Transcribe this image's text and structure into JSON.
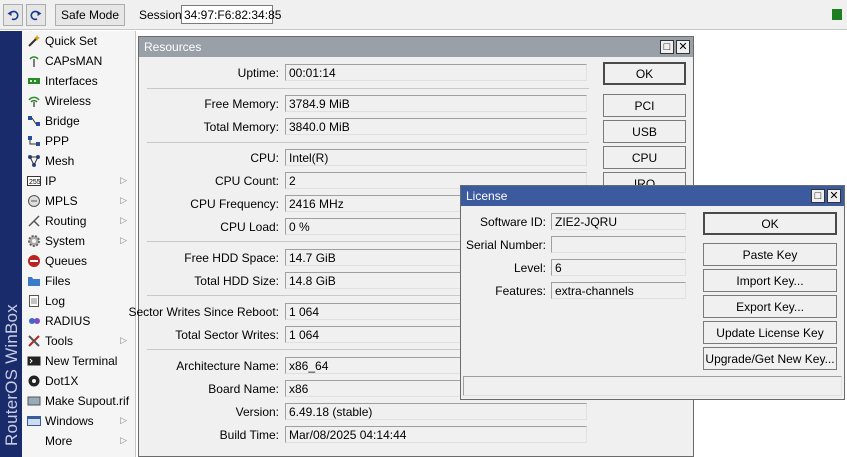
{
  "toolbar": {
    "safe_mode_label": "Safe Mode",
    "session_label": "Session:",
    "session_value": "34:97:F6:82:34:85"
  },
  "brand": "RouterOS WinBox",
  "sidebar": {
    "items": [
      {
        "label": "Quick Set",
        "icon": "wand-icon"
      },
      {
        "label": "CAPsMAN",
        "icon": "antenna-icon"
      },
      {
        "label": "Interfaces",
        "icon": "interfaces-icon"
      },
      {
        "label": "Wireless",
        "icon": "wireless-icon"
      },
      {
        "label": "Bridge",
        "icon": "bridge-icon"
      },
      {
        "label": "PPP",
        "icon": "ppp-icon"
      },
      {
        "label": "Mesh",
        "icon": "mesh-icon"
      },
      {
        "label": "IP",
        "icon": "ip-icon"
      },
      {
        "label": "MPLS",
        "icon": "mpls-icon"
      },
      {
        "label": "Routing",
        "icon": "routing-icon"
      },
      {
        "label": "System",
        "icon": "gear-icon"
      },
      {
        "label": "Queues",
        "icon": "queues-icon"
      },
      {
        "label": "Files",
        "icon": "folder-icon"
      },
      {
        "label": "Log",
        "icon": "log-icon"
      },
      {
        "label": "RADIUS",
        "icon": "radius-icon"
      },
      {
        "label": "Tools",
        "icon": "tools-icon"
      },
      {
        "label": "New Terminal",
        "icon": "terminal-icon"
      },
      {
        "label": "Dot1X",
        "icon": "dot1x-icon"
      },
      {
        "label": "Make Supout.rif",
        "icon": "supout-icon"
      },
      {
        "label": "Windows",
        "icon": "windows-icon"
      },
      {
        "label": "More",
        "icon": ""
      }
    ]
  },
  "resources": {
    "title": "Resources",
    "uptime_label": "Uptime:",
    "uptime": "00:01:14",
    "free_memory_label": "Free Memory:",
    "free_memory": "3784.9 MiB",
    "total_memory_label": "Total Memory:",
    "total_memory": "3840.0 MiB",
    "cpu_label": "CPU:",
    "cpu": "Intel(R)",
    "cpu_count_label": "CPU Count:",
    "cpu_count": "2",
    "cpu_frequency_label": "CPU Frequency:",
    "cpu_frequency": "2416 MHz",
    "cpu_load_label": "CPU Load:",
    "cpu_load": "0 %",
    "free_hdd_label": "Free HDD Space:",
    "free_hdd": "14.7 GiB",
    "total_hdd_label": "Total HDD Size:",
    "total_hdd": "14.8 GiB",
    "sector_writes_reboot_label": "Sector Writes Since Reboot:",
    "sector_writes_reboot": "1 064",
    "total_sector_writes_label": "Total Sector Writes:",
    "total_sector_writes": "1 064",
    "architecture_label": "Architecture Name:",
    "architecture": "x86_64",
    "board_label": "Board Name:",
    "board": "x86",
    "version_label": "Version:",
    "version": "6.49.18 (stable)",
    "build_time_label": "Build Time:",
    "build_time": "Mar/08/2025 04:14:44",
    "buttons": {
      "ok": "OK",
      "pci": "PCI",
      "usb": "USB",
      "cpu": "CPU",
      "irq": "IRQ"
    }
  },
  "license": {
    "title": "License",
    "software_id_label": "Software ID:",
    "software_id": "ZIE2-JQRU",
    "serial_label": "Serial Number:",
    "serial": "",
    "level_label": "Level:",
    "level": "6",
    "features_label": "Features:",
    "features": "extra-channels",
    "buttons": {
      "ok": "OK",
      "paste_key": "Paste Key",
      "import_key": "Import Key...",
      "export_key": "Export Key...",
      "update_license_key": "Update License Key",
      "upgrade_key": "Upgrade/Get New Key..."
    }
  },
  "colors": {
    "brand_strip": "#1a2b6b",
    "active_title": "#3c5a9e",
    "inactive_title": "#9aa0a8",
    "status_indicator": "#1e7d1e"
  }
}
